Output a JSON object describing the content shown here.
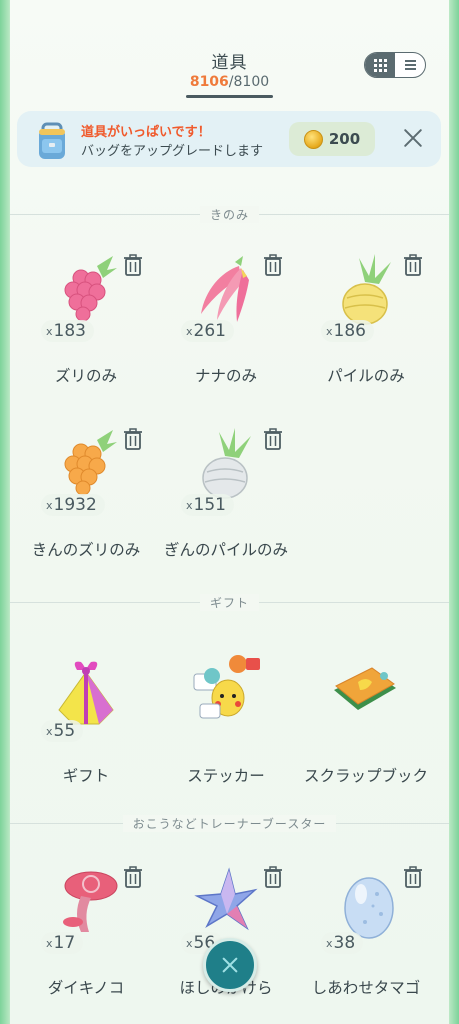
{
  "header": {
    "title": "道具",
    "count_current": "8106",
    "count_sep": "/",
    "count_max": "8100",
    "view_toggle": {
      "grid": "grid-icon",
      "list": "list-icon",
      "active": "grid"
    }
  },
  "banner": {
    "title": "道具がいっぱいです！",
    "subtitle": "バッグをアップグレードします",
    "price": "200",
    "icon": "backpack-icon"
  },
  "sections": {
    "berries": "きのみ",
    "gifts": "ギフト",
    "boosters": "おこうなどトレーナーブースター"
  },
  "items": {
    "razz": {
      "qty": "183",
      "name": "ズリのみ"
    },
    "nanab": {
      "qty": "261",
      "name": "ナナのみ"
    },
    "pinap": {
      "qty": "186",
      "name": "パイルのみ"
    },
    "golden_razz": {
      "qty": "1932",
      "name": "きんのズリのみ"
    },
    "silver_pinap": {
      "qty": "151",
      "name": "ぎんのパイルのみ"
    },
    "gift": {
      "qty": "55",
      "name": "ギフト"
    },
    "sticker": {
      "name": "ステッカー"
    },
    "scrapbook": {
      "name": "スクラップブック"
    },
    "mushroom": {
      "qty": "17",
      "name": "ダイキノコ"
    },
    "stardust_piece": {
      "qty": "56",
      "name": "ほしのかけら"
    },
    "lucky_egg": {
      "qty": "38",
      "name": "しあわせタマゴ"
    }
  },
  "qty_prefix": "x",
  "colors": {
    "accent": "#ef7a3b",
    "warning": "#f05a2c",
    "fab": "#1f7f89"
  }
}
